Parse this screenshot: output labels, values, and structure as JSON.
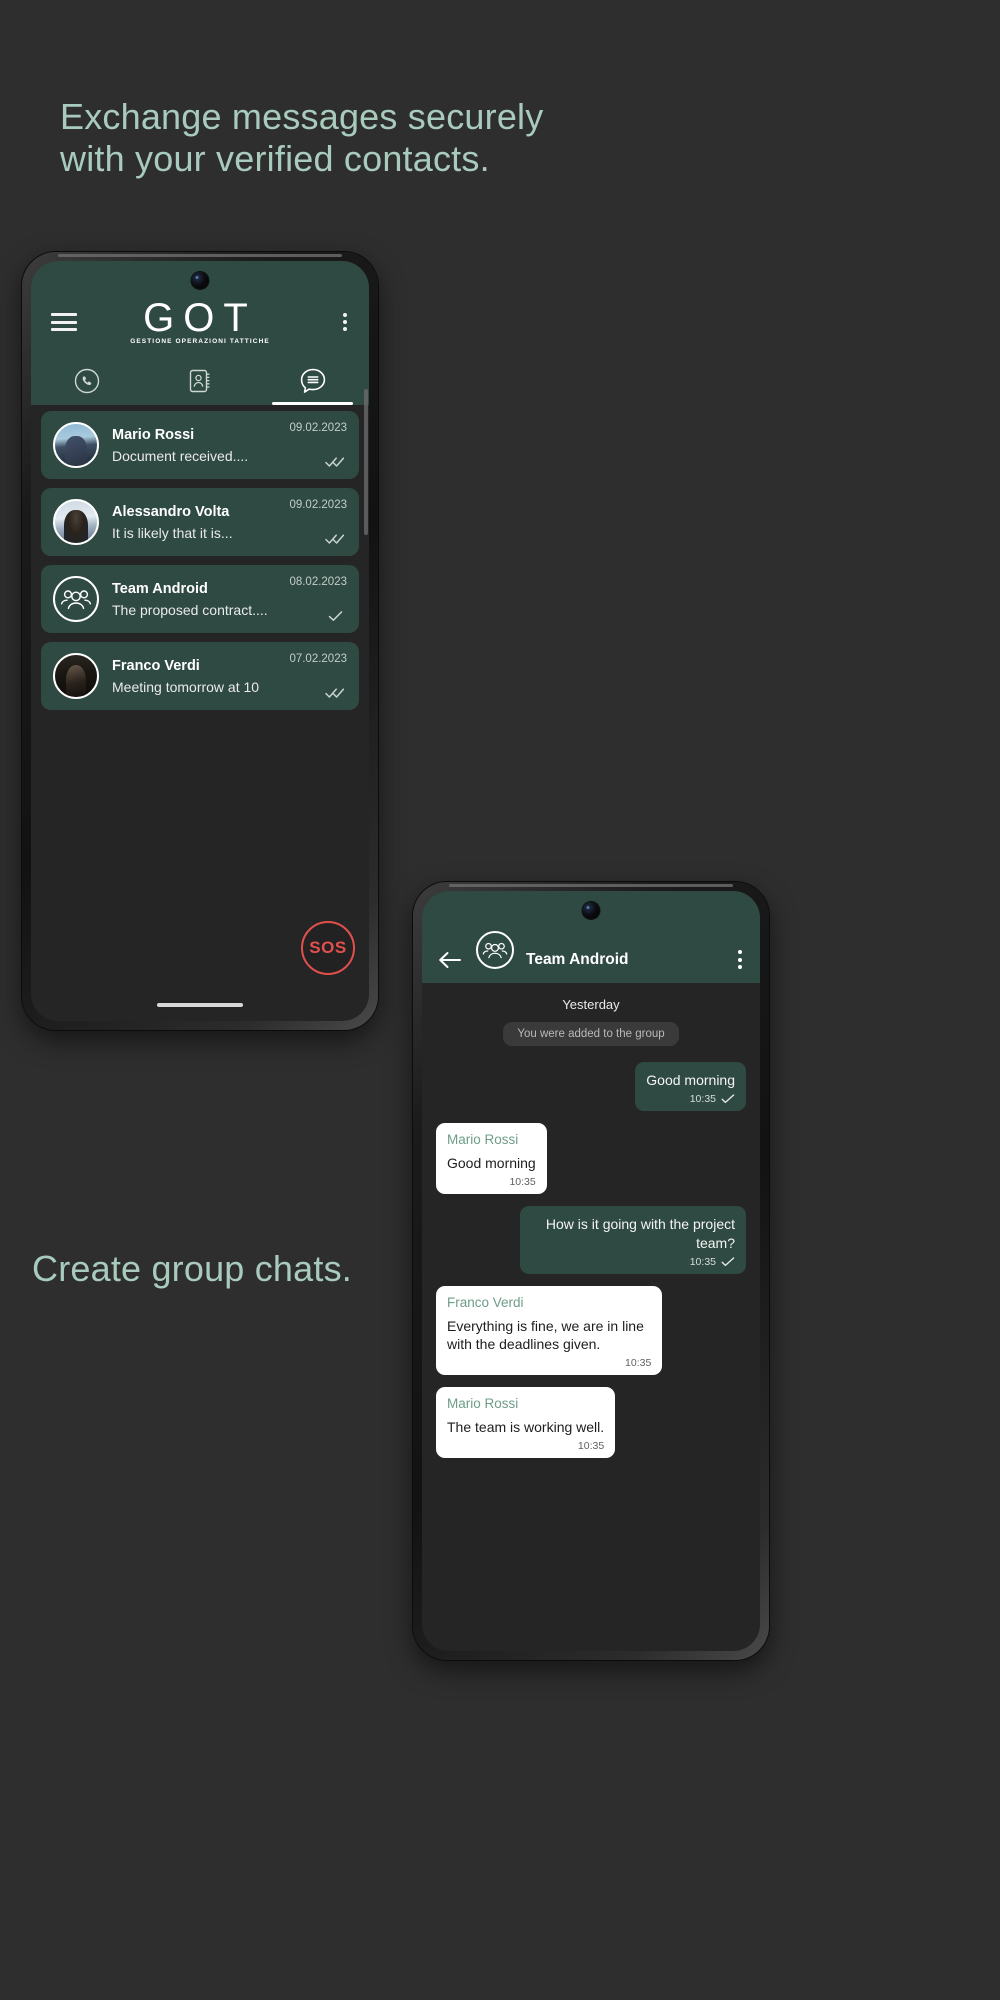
{
  "palette": {
    "page_bg": "#2e2e2e",
    "caption_green": "#a8cbbd",
    "app_green": "#2f4a42",
    "bubble_in_bg": "#ffffff",
    "sender_green": "#6f9c87",
    "sos_red": "#e2504e",
    "screen_bg": "#252525"
  },
  "captions": {
    "top": "Exchange messages securely\nwith your verified contacts.",
    "bottom": "Create group chats."
  },
  "phone_chatlist": {
    "header": {
      "menu_icon": "hamburger-menu-icon",
      "logo_mark": "GOT",
      "logo_subtitle": "GESTIONE   OPERAZIONI   TATTICHE",
      "overflow_icon": "kebab-menu-icon"
    },
    "tabs": [
      {
        "name": "calls",
        "icon": "phone-icon",
        "active": false
      },
      {
        "name": "contacts",
        "icon": "address-book-icon",
        "active": false
      },
      {
        "name": "chats",
        "icon": "chat-bubble-icon",
        "active": true
      }
    ],
    "chats": [
      {
        "name": "Mario Rossi",
        "preview": "Document received....",
        "date": "09.02.2023",
        "status": "read",
        "avatar": "photo"
      },
      {
        "name": "Alessandro Volta",
        "preview": "It is likely that it is...",
        "date": "09.02.2023",
        "status": "read",
        "avatar": "photo"
      },
      {
        "name": "Team Android",
        "preview": "The proposed contract....",
        "date": "08.02.2023",
        "status": "sent",
        "avatar": "group"
      },
      {
        "name": "Franco Verdi",
        "preview": "Meeting tomorrow at 10",
        "date": "07.02.2023",
        "status": "read",
        "avatar": "photo"
      }
    ],
    "sos_label": "SOS"
  },
  "phone_conversation": {
    "header": {
      "back_icon": "arrow-left-icon",
      "avatar_icon": "group-avatar-icon",
      "title": "Team Android",
      "overflow_icon": "kebab-menu-icon"
    },
    "date_divider": "Yesterday",
    "system_message": "You were added to the group",
    "messages": [
      {
        "direction": "out",
        "sender": "",
        "body": "Good morning",
        "time": "10:35",
        "status": "sent"
      },
      {
        "direction": "in",
        "sender": "Mario Rossi",
        "body": "Good morning",
        "time": "10:35",
        "status": ""
      },
      {
        "direction": "out",
        "sender": "",
        "body": "How is it going with the project team?",
        "time": "10:35",
        "status": "sent"
      },
      {
        "direction": "in",
        "sender": "Franco Verdi",
        "body": "Everything is fine, we are in line with the deadlines given.",
        "time": "10:35",
        "status": ""
      },
      {
        "direction": "in",
        "sender": "Mario Rossi",
        "body": "The team is working well.",
        "time": "10:35",
        "status": ""
      }
    ]
  }
}
